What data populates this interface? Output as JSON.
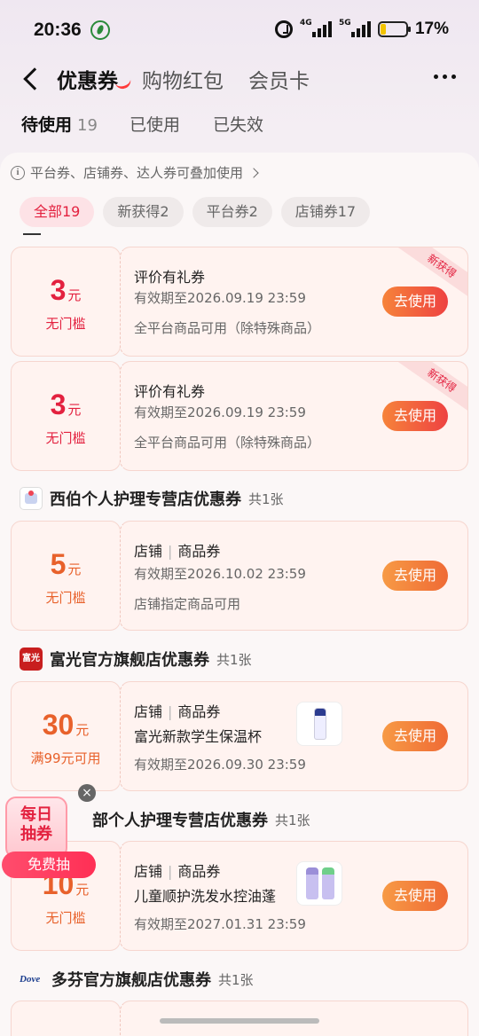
{
  "status_bar": {
    "time": "20:36",
    "net1": "4G",
    "net2": "5G",
    "battery": "17%"
  },
  "nav": {
    "tabs": [
      {
        "label": "优惠券",
        "active": true
      },
      {
        "label": "购物红包",
        "active": false
      },
      {
        "label": "会员卡",
        "active": false
      }
    ]
  },
  "subtabs": [
    {
      "label": "待使用",
      "count": "19",
      "active": true
    },
    {
      "label": "已使用",
      "count": "",
      "active": false
    },
    {
      "label": "已失效",
      "count": "",
      "active": false
    }
  ],
  "tip": "平台券、店铺券、达人券可叠加使用",
  "filters": [
    "全部19",
    "新获得2",
    "平台券2",
    "店铺券17"
  ],
  "coupons": [
    {
      "amount": "3",
      "unit": "元",
      "condition": "无门槛",
      "title": "评价有礼券",
      "validity": "有效期至2026.09.19 23:59",
      "scope": "全平台商品可用（除特殊商品）",
      "button": "去使用",
      "ribbon": "新获得"
    },
    {
      "amount": "3",
      "unit": "元",
      "condition": "无门槛",
      "title": "评价有礼券",
      "validity": "有效期至2026.09.19 23:59",
      "scope": "全平台商品可用（除特殊商品）",
      "button": "去使用",
      "ribbon": "新获得"
    },
    {
      "amount": "5",
      "unit": "元",
      "condition": "无门槛",
      "type1": "店铺",
      "type2": "商品券",
      "validity": "有效期至2026.10.02 23:59",
      "scope": "店铺指定商品可用",
      "button": "去使用"
    },
    {
      "amount": "30",
      "unit": "元",
      "condition": "满99元可用",
      "type1": "店铺",
      "type2": "商品券",
      "product": "富光新款学生保温杯",
      "validity": "有效期至2026.09.30 23:59",
      "button": "去使用"
    },
    {
      "amount": "10",
      "unit": "元",
      "condition": "无门槛",
      "type1": "店铺",
      "type2": "商品券",
      "product": "儿童顺护洗发水控油蓬",
      "validity": "有效期至2027.01.31 23:59",
      "button": "去使用"
    }
  ],
  "stores": [
    {
      "name": "西伯个人护理专营店优惠券",
      "total": "共1张"
    },
    {
      "name": "富光官方旗舰店优惠券",
      "total": "共1张",
      "logo_text": "富光"
    },
    {
      "name": "部个人护理专营店优惠券",
      "total": "共1张"
    },
    {
      "name": "多芬官方旗舰店优惠券",
      "total": "共1张",
      "logo_text": "Dove"
    }
  ],
  "float_banner": {
    "line1": "每日",
    "line2": "抽券",
    "pill": "免费抽",
    "close": "×"
  }
}
